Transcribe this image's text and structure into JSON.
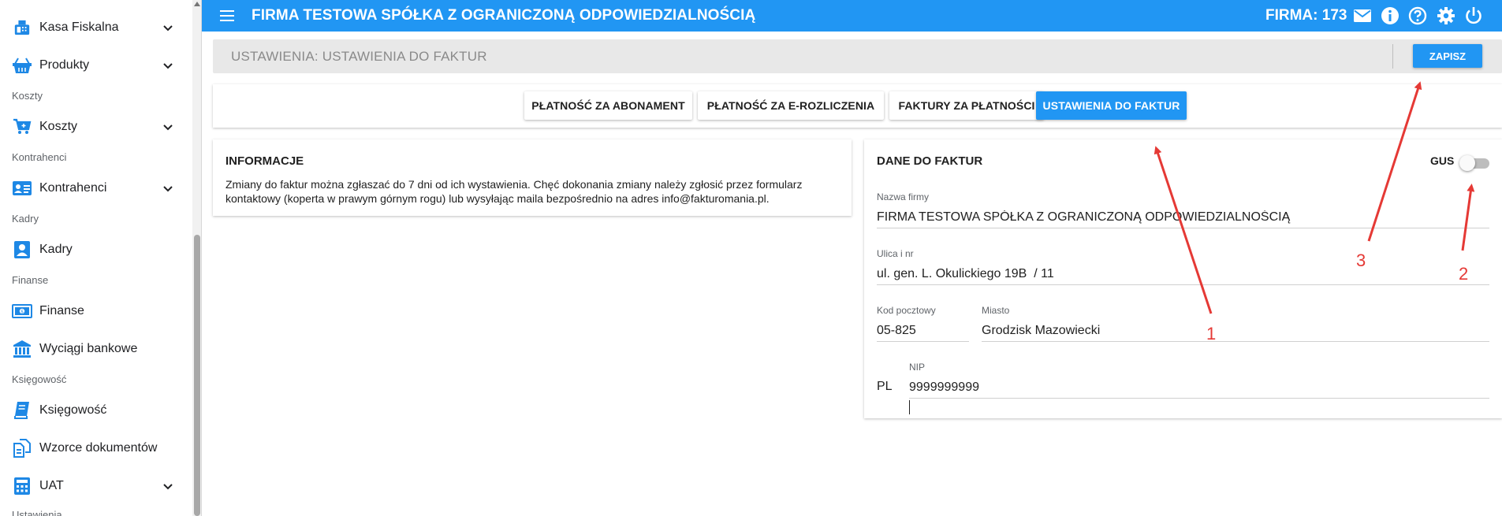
{
  "sidebar": {
    "items": [
      {
        "label": "Kasa Fiskalna",
        "icon": "fax-icon"
      },
      {
        "label": "Produkty",
        "icon": "basket-icon"
      },
      {
        "label": "Koszty",
        "icon": "cart-icon"
      },
      {
        "label": "Kontrahenci",
        "icon": "contacts-card-icon"
      },
      {
        "label": "Kadry",
        "icon": "person-badge-icon"
      },
      {
        "label": "Finanse",
        "icon": "banknote-icon"
      },
      {
        "label": "Wyciągi bankowe",
        "icon": "bank-icon"
      },
      {
        "label": "Księgowość",
        "icon": "book-icon"
      },
      {
        "label": "Wzorce dokumentów",
        "icon": "documents-icon"
      },
      {
        "label": "UAT",
        "icon": "calculator-icon"
      }
    ],
    "sections": [
      "Koszty",
      "Kontrahenci",
      "Kadry",
      "Finanse",
      "Księgowość",
      "Ustawienia"
    ]
  },
  "topbar": {
    "title": "FIRMA TESTOWA SPÓŁKA Z OGRANICZONĄ ODPOWIEDZIALNOŚCIĄ",
    "firma": "FIRMA: 173",
    "icons": [
      "mail-icon",
      "info-icon",
      "help-icon",
      "settings-icon",
      "power-icon"
    ],
    "color": "#2196f3"
  },
  "header": {
    "title": "USTAWIENIA: USTAWIENIA DO FAKTUR",
    "save_label": "ZAPISZ"
  },
  "tabs": [
    {
      "label": "PŁATNOŚĆ ZA ABONAMENT",
      "active": false
    },
    {
      "label": "PŁATNOŚĆ ZA E-ROZLICZENIA",
      "active": false
    },
    {
      "label": "FAKTURY ZA PŁATNOŚCI",
      "active": false
    },
    {
      "label": "USTAWIENIA DO FAKTUR",
      "active": true
    }
  ],
  "info": {
    "title": "INFORMACJE",
    "text": "Zmiany do faktur można zgłaszać do 7 dni od ich wystawienia. Chęć dokonania zmiany należy zgłosić przez formularz kontaktowy (koperta w prawym górnym rogu) lub wysyłając maila bezpośrednio na adres info@fakturomania.pl."
  },
  "dane": {
    "title": "DANE DO FAKTUR",
    "gus_label": "GUS",
    "gus_enabled": false,
    "fields": {
      "nazwa_label": "Nazwa firmy",
      "nazwa_value": "FIRMA TESTOWA SPÓŁKA Z OGRANICZONĄ ODPOWIEDZIALNOŚCIĄ",
      "ulica_label": "Ulica i nr",
      "ulica_value": "ul. gen. L. Okulickiego 19B  / 11",
      "kod_label": "Kod pocztowy",
      "kod_value": "05-825",
      "miasto_label": "Miasto",
      "miasto_value": "Grodzisk Mazowiecki",
      "nip_prefix": "PL",
      "nip_label": "NIP",
      "nip_value": "9999999999"
    }
  },
  "annotations": {
    "color": "#e53935",
    "labels": [
      "1",
      "2",
      "3"
    ]
  }
}
